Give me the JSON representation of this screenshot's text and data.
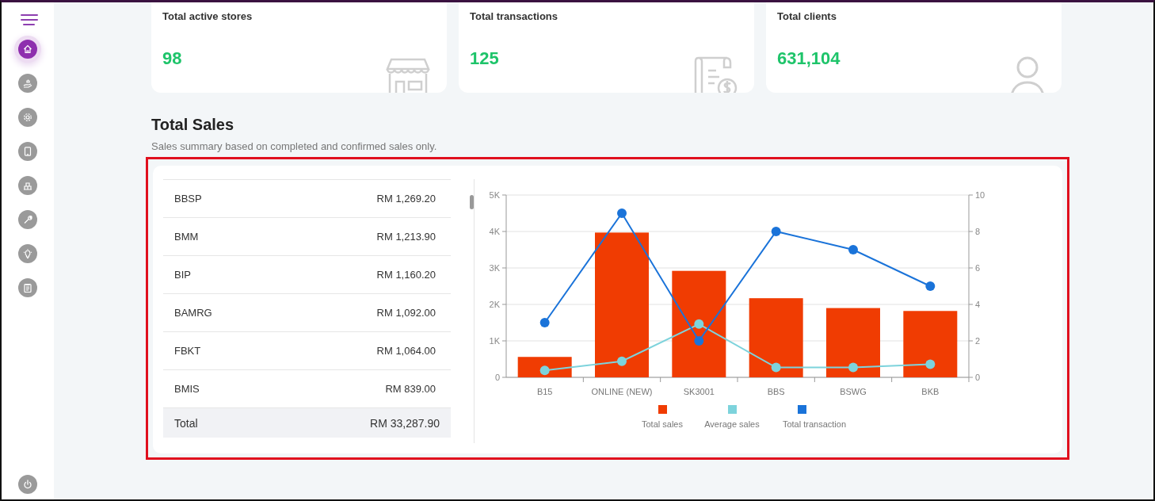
{
  "sidebar": {
    "items": [
      {
        "selected": true
      },
      {
        "selected": false
      },
      {
        "selected": false
      },
      {
        "selected": false
      },
      {
        "selected": false
      },
      {
        "selected": false
      },
      {
        "selected": false
      },
      {
        "selected": false
      }
    ]
  },
  "stats": [
    {
      "label": "Total active stores",
      "value": "98",
      "kind": "store"
    },
    {
      "label": "Total transactions",
      "value": "125",
      "kind": "receipt"
    },
    {
      "label": "Total clients",
      "value": "631,104",
      "kind": "person"
    }
  ],
  "section": {
    "title": "Total Sales",
    "subtitle": "Sales summary based on completed and confirmed sales only."
  },
  "sales_table": {
    "rows": [
      {
        "name": "BBSP",
        "amount": "RM 1,269.20"
      },
      {
        "name": "BMM",
        "amount": "RM 1,213.90"
      },
      {
        "name": "BIP",
        "amount": "RM 1,160.20"
      },
      {
        "name": "BAMRG",
        "amount": "RM 1,092.00"
      },
      {
        "name": "FBKT",
        "amount": "RM 1,064.00"
      },
      {
        "name": "BMIS",
        "amount": "RM 839.00"
      }
    ],
    "total": {
      "label": "Total",
      "amount": "RM 33,287.90"
    }
  },
  "chart_data": {
    "type": "bar",
    "categories": [
      "B15",
      "ONLINE (NEW)",
      "SK3001",
      "BBS",
      "BSWG",
      "BKB"
    ],
    "series": [
      {
        "name": "Total sales",
        "color": "#f03c02",
        "type": "bar",
        "values": [
          560,
          3970,
          2920,
          2170,
          1900,
          1820
        ]
      },
      {
        "name": "Average sales",
        "color": "#7dd3dc",
        "type": "line",
        "marker": "circle",
        "values": [
          190,
          440,
          1460,
          270,
          270,
          360
        ]
      },
      {
        "name": "Total transaction",
        "color": "#1a73d9",
        "type": "line",
        "marker": "circle",
        "axis": "y2",
        "values": [
          3,
          9,
          2,
          8,
          7,
          5
        ]
      }
    ],
    "stacked": false,
    "grid": true,
    "legend": "bottom",
    "ylim": [
      0,
      5000
    ],
    "yticks": [
      {
        "value": 0,
        "label": "0"
      },
      {
        "value": 1000,
        "label": "1K"
      },
      {
        "value": 2000,
        "label": "2K"
      },
      {
        "value": 3000,
        "label": "3K"
      },
      {
        "value": 4000,
        "label": "4K"
      },
      {
        "value": 5000,
        "label": "5K"
      }
    ],
    "y2lim": [
      0,
      10
    ],
    "y2ticks": [
      0,
      2,
      4,
      6,
      8,
      10
    ]
  }
}
